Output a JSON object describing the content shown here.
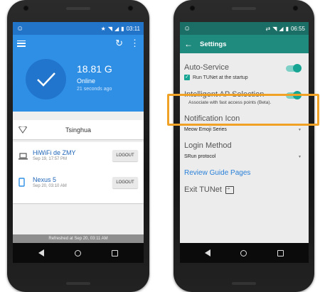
{
  "left_phone": {
    "status_bar": {
      "time": "03:11",
      "left_icon": "emoji-icon",
      "right_icons": [
        "star-icon",
        "wifi-icon",
        "signal-icon",
        "battery-icon"
      ]
    },
    "toolbar": {
      "menu_icon": "menu-icon",
      "refresh_icon": "refresh-icon",
      "more_icon": "more-vert-icon"
    },
    "status": {
      "usage": "18.81 G",
      "state": "Online",
      "updated": "21 seconds ago"
    },
    "network": {
      "name": "Tsinghua",
      "icon": "wifi-outline-icon"
    },
    "devices": [
      {
        "name": "HiWiFi de ZMY",
        "time": "Sep 19, 17:57 PM",
        "action": "LOGOUT",
        "icon": "laptop-icon"
      },
      {
        "name": "Nexus 5",
        "time": "Sep 20, 03:10 AM",
        "action": "LOGOUT",
        "icon": "phone-icon"
      }
    ],
    "footer": "Refreshed at Sep 20, 03:11 AM",
    "colors": {
      "primary": "#2e8fe5",
      "circle": "#2275cc",
      "link": "#1e64b8"
    }
  },
  "right_phone": {
    "status_bar": {
      "time": "06:55",
      "left_icon": "emoji-icon",
      "right_icons": [
        "sync-icon",
        "wifi-icon",
        "signal-icon",
        "battery-icon"
      ]
    },
    "toolbar": {
      "title": "Settings",
      "back_icon": "arrow-back-icon"
    },
    "settings": {
      "auto_service": {
        "title": "Auto-Service",
        "enabled": true,
        "checkbox_label": "Run TUNet at the startup",
        "checked": true
      },
      "intelligent_ap": {
        "title": "Intelligent AP Selection",
        "enabled": true,
        "summary": "Associate with fast access points (Beta)."
      },
      "notification_icon": {
        "title": "Notification Icon",
        "value": "Meow Emoji Series"
      },
      "login_method": {
        "title": "Login Method",
        "value": "SRun protocol"
      },
      "review_guide": "Review Guide Pages",
      "exit": "Exit TUNet"
    },
    "colors": {
      "primary": "#1f8a7e",
      "accent": "#17a593",
      "link": "#2980d9",
      "highlight": "#f0a227"
    }
  }
}
